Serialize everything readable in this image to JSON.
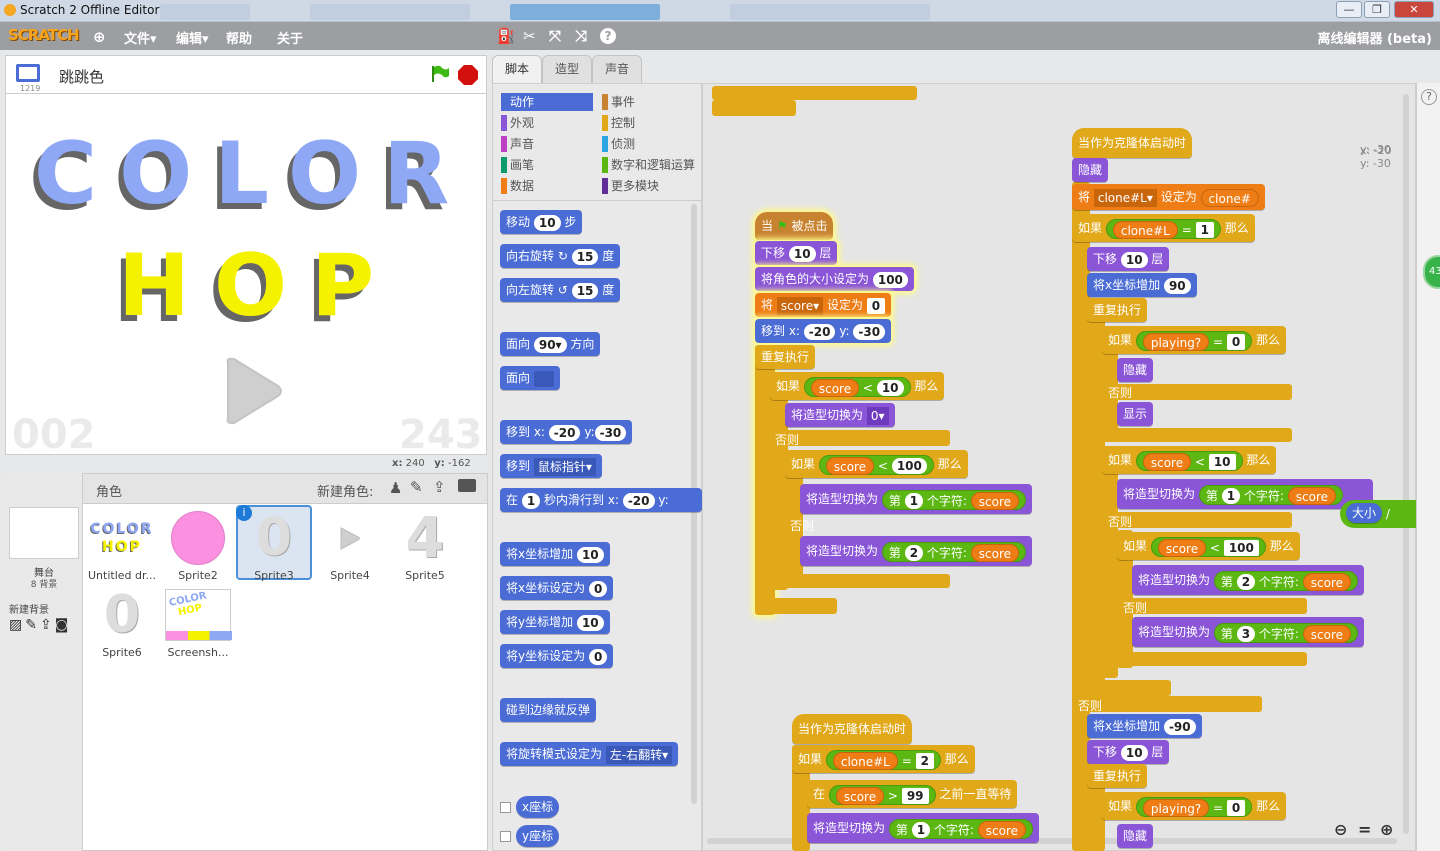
{
  "window": {
    "title": "Scratch 2 Offline Editor",
    "minimize": "—",
    "maximize": "❐",
    "close": "✕"
  },
  "menu": {
    "logo": "SCRATCH",
    "globe": "⊕",
    "file": "文件▾",
    "edit": "编辑▾",
    "help": "帮助",
    "about": "关于",
    "offline": "离线编辑器 (beta)"
  },
  "toolbar": {
    "stamp": "⛽",
    "cut": "✂",
    "grow": "⤧",
    "shrink": "⤨",
    "help": "?"
  },
  "stage": {
    "project_name": "跳跳色",
    "version": "1219",
    "color_text": "COLOR",
    "hop_text": "HOP",
    "score_left": "002",
    "score_right": "243",
    "x_label": "x:",
    "x": "240",
    "y_label": "y:",
    "y": "-162"
  },
  "sprites": {
    "title": "角色",
    "new_label": "新建角色:",
    "stage_label": "舞台",
    "backdrop_count": "8 背景",
    "new_backdrop": "新建背景",
    "items": [
      {
        "name": "Untitled dr...",
        "kind": "logo"
      },
      {
        "name": "Sprite2",
        "kind": "pink"
      },
      {
        "name": "Sprite3",
        "kind": "zero"
      },
      {
        "name": "Sprite4",
        "kind": "play"
      },
      {
        "name": "Sprite5",
        "kind": "four"
      },
      {
        "name": "Sprite6",
        "kind": "zero"
      },
      {
        "name": "Screensh...",
        "kind": "shot"
      }
    ]
  },
  "tabs": [
    "脚本",
    "造型",
    "声音"
  ],
  "categories": {
    "left": [
      {
        "label": "动作",
        "color": "#4a6cd4"
      },
      {
        "label": "外观",
        "color": "#8a55d7"
      },
      {
        "label": "声音",
        "color": "#bb42c3"
      },
      {
        "label": "画笔",
        "color": "#0e9a6c"
      },
      {
        "label": "数据",
        "color": "#ee7d16"
      }
    ],
    "right": [
      {
        "label": "事件",
        "color": "#c88330"
      },
      {
        "label": "控制",
        "color": "#e1a91a"
      },
      {
        "label": "侦测",
        "color": "#2ca5e2"
      },
      {
        "label": "数字和逻辑运算",
        "color": "#5cb712"
      },
      {
        "label": "更多模块",
        "color": "#632d99"
      }
    ]
  },
  "palette": {
    "b1": "移动",
    "b1v": "10",
    "b1u": "步",
    "b2": "向右旋转 ↻",
    "b2v": "15",
    "b2u": "度",
    "b3": "向左旋转 ↺",
    "b3v": "15",
    "b3u": "度",
    "b4": "面向",
    "b4v": "90▾",
    "b4u": "方向",
    "b5": "面向",
    "b6": "移到 x:",
    "b6x": "-20",
    "b6y": "y:",
    "b6yv": "-30",
    "b7": "移到",
    "b7v": "鼠标指针▾",
    "b8": "在",
    "b8v": "1",
    "b8m": "秒内滑行到 x:",
    "b8x": "-20",
    "b8y": "y:",
    "b9": "将x坐标增加",
    "b9v": "10",
    "b10": "将x坐标设定为",
    "b10v": "0",
    "b11": "将y坐标增加",
    "b11v": "10",
    "b12": "将y坐标设定为",
    "b12v": "0",
    "b13": "碰到边缘就反弹",
    "b14": "将旋转模式设定为",
    "b14v": "左-右翻转▾",
    "r1": "x座标",
    "r2": "y座标"
  },
  "scripts": {
    "s1_hat1": "当",
    "s1_hat2": "被点击",
    "s1_a": "下移",
    "s1_av": "10",
    "s1_au": "层",
    "s1_b": "将角色的大小设定为",
    "s1_bv": "100",
    "s1_c": "将",
    "s1_cvar": "score▾",
    "s1_cm": "设定为",
    "s1_cv": "0",
    "s1_d": "移到 x:",
    "s1_dx": "-20",
    "s1_dy": "y:",
    "s1_dyv": "-30",
    "forever": "重复执行",
    "if": "如果",
    "then": "那么",
    "else": "否则",
    "score": "score",
    "lt": "<",
    "eq": "=",
    "gt": ">",
    "ten": "10",
    "hundred": "100",
    "costume": "将造型切换为",
    "costume0": "0▾",
    "nth": "第",
    "ch1": "1",
    "ch2": "2",
    "ch3": "3",
    "chars": "个字符:",
    "clone_hat": "当作为克隆体启动时",
    "hide": "隐藏",
    "show": "显示",
    "set": "将",
    "clonevar": "clone#L▾",
    "setto": "设定为",
    "clonenum": "clone#",
    "cloneL": "clone#L",
    "one": "1",
    "two": "2",
    "down": "下移",
    "layer": "层",
    "xinc": "将x坐标增加",
    "ninety": "90",
    "neg90": "-90",
    "playing": "playing?",
    "zero": "0",
    "wait": "在",
    "waitv": "99",
    "waitm": "之前一直等待",
    "size": "大小",
    "slash": "/",
    "coordx": "x: -20",
    "coordy": "y: -30",
    "count": "43"
  }
}
